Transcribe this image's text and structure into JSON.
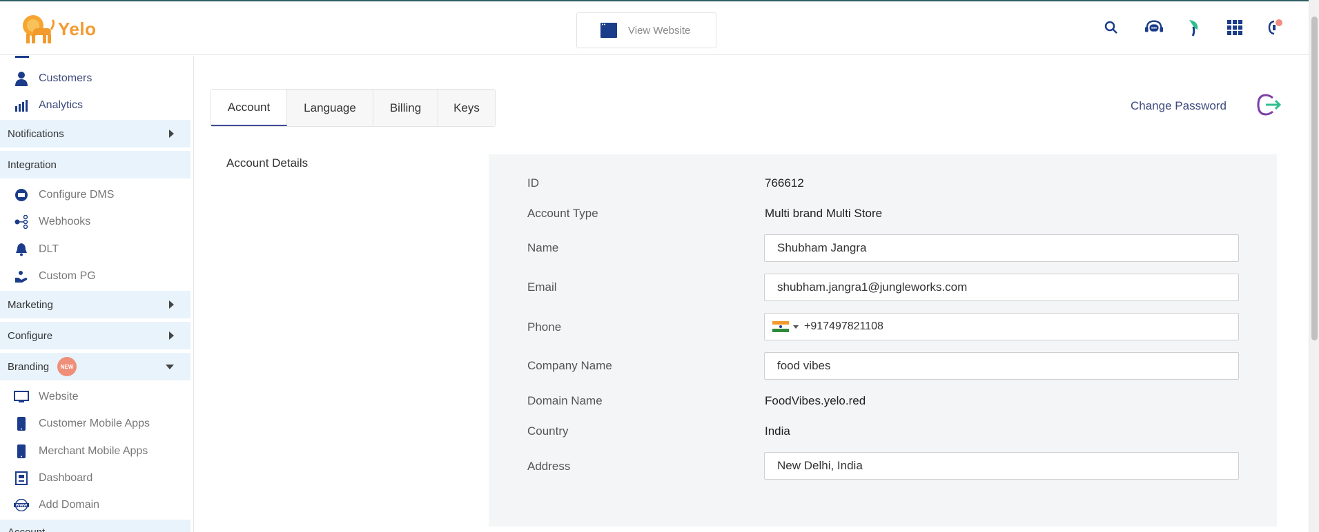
{
  "header": {
    "logo_text": "Yelo",
    "view_website_label": "View Website",
    "icons": [
      "search-icon",
      "support-chat-icon",
      "leaf-icon",
      "apps-grid-icon",
      "notification-icon"
    ],
    "accent_color": "#1b3c8a"
  },
  "sidebar": {
    "items_top": [
      {
        "label": "Customers",
        "icon": "customer-icon"
      },
      {
        "label": "Analytics",
        "icon": "analytics-icon"
      }
    ],
    "notifications": "Notifications",
    "integration": "Integration",
    "integration_items": [
      {
        "label": "Configure DMS",
        "icon": "dms-icon"
      },
      {
        "label": "Webhooks",
        "icon": "webhooks-icon"
      },
      {
        "label": "DLT",
        "icon": "bell-icon"
      },
      {
        "label": "Custom PG",
        "icon": "payment-icon"
      }
    ],
    "marketing": "Marketing",
    "configure": "Configure",
    "branding": "Branding",
    "new_badge": "NEW",
    "branding_items": [
      {
        "label": "Website",
        "icon": "monitor-icon"
      },
      {
        "label": "Customer Mobile Apps",
        "icon": "mobile-icon"
      },
      {
        "label": "Merchant Mobile Apps",
        "icon": "mobile-icon"
      },
      {
        "label": "Dashboard",
        "icon": "dashboard-icon"
      },
      {
        "label": "Add Domain",
        "icon": "www-icon"
      }
    ],
    "account": "Account"
  },
  "tabs": [
    "Account",
    "Language",
    "Billing",
    "Keys"
  ],
  "change_password": "Change Password",
  "section_title": "Account Details",
  "fields": {
    "id": {
      "label": "ID",
      "value": "766612"
    },
    "account_type": {
      "label": "Account Type",
      "value": "Multi brand Multi Store"
    },
    "name": {
      "label": "Name",
      "value": "Shubham Jangra"
    },
    "email": {
      "label": "Email",
      "value": "shubham.jangra1@jungleworks.com"
    },
    "phone": {
      "label": "Phone",
      "value": "+917497821108"
    },
    "company_name": {
      "label": "Company Name",
      "value": "food vibes"
    },
    "domain_name": {
      "label": "Domain Name",
      "value": "FoodVibes.yelo.red"
    },
    "country": {
      "label": "Country",
      "value": "India"
    },
    "address": {
      "label": "Address",
      "value": "New Delhi, India"
    }
  }
}
